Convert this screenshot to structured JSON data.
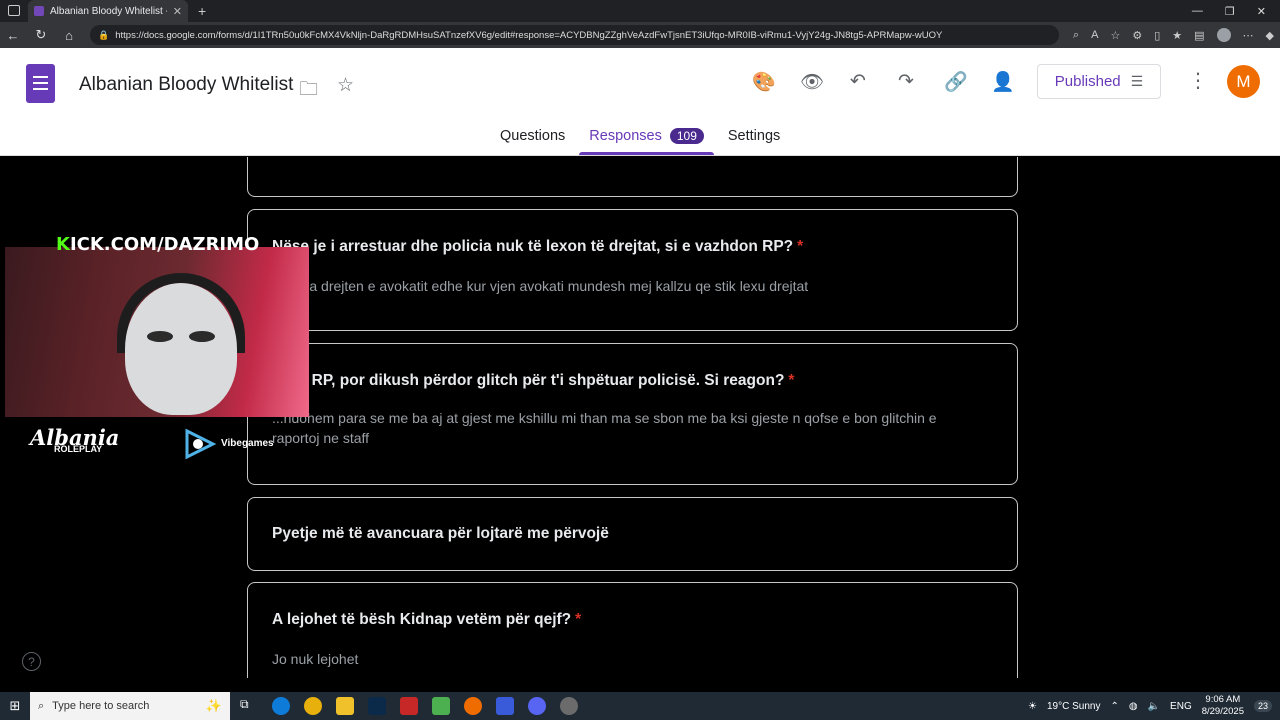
{
  "browser": {
    "tab_title": "Albanian Bloody Whitelist - Goog",
    "url": "https://docs.google.com/forms/d/1I1TRn50u0kFcMX4VkNljn-DaRgRDMHsuSATnzefXV6g/edit#response=ACYDBNgZZghVeAzdFwTjsnET3iUfqo-MR0IB-viRmu1-VyjY24g-JN8tg5-APRMapw-wUOY"
  },
  "form": {
    "title": "Albanian Bloody Whitelist",
    "published_label": "Published",
    "avatar_initial": "M",
    "tabs": {
      "questions": "Questions",
      "responses": "Responses",
      "responses_count": "109",
      "settings": "Settings"
    }
  },
  "cards": [
    {
      "question": "Nëse je i arrestuar dhe policia nuk të lexon të drejtat, si e vazhdon RP?",
      "required": "*",
      "answer": "...oli pa drejten e avokatit edhe kur vjen avokati mundesh mej kallzu qe stik lexu drejtat"
    },
    {
      "question": "...një RP, por dikush përdor glitch për t'i shpëtuar policisë. Si reagon?",
      "required": "*",
      "answer": "...ndohem para se me ba aj at gjest me kshillu mi than ma se sbon me ba ksi gjeste n qofse e bon glitchin e raportoj ne staff"
    },
    {
      "section": "Pyetje më të avancuara për lojtarë me përvojë"
    },
    {
      "question": "A lejohet të bësh Kidnap vetëm për qejf?",
      "required": "*",
      "answer": "Jo nuk lejohet"
    }
  ],
  "overlay": {
    "kick_k": "K",
    "kick_rest": "ICK.COM/DAZRIMO",
    "server_logo": "Albania",
    "server_sub": "ROLEPLAY",
    "sponsor": "Vibegames"
  },
  "taskbar": {
    "search_placeholder": "Type here to search",
    "weather": "19°C  Sunny",
    "lang": "ENG",
    "time": "9:06 AM",
    "date": "8/29/2025",
    "notifications": "23"
  }
}
